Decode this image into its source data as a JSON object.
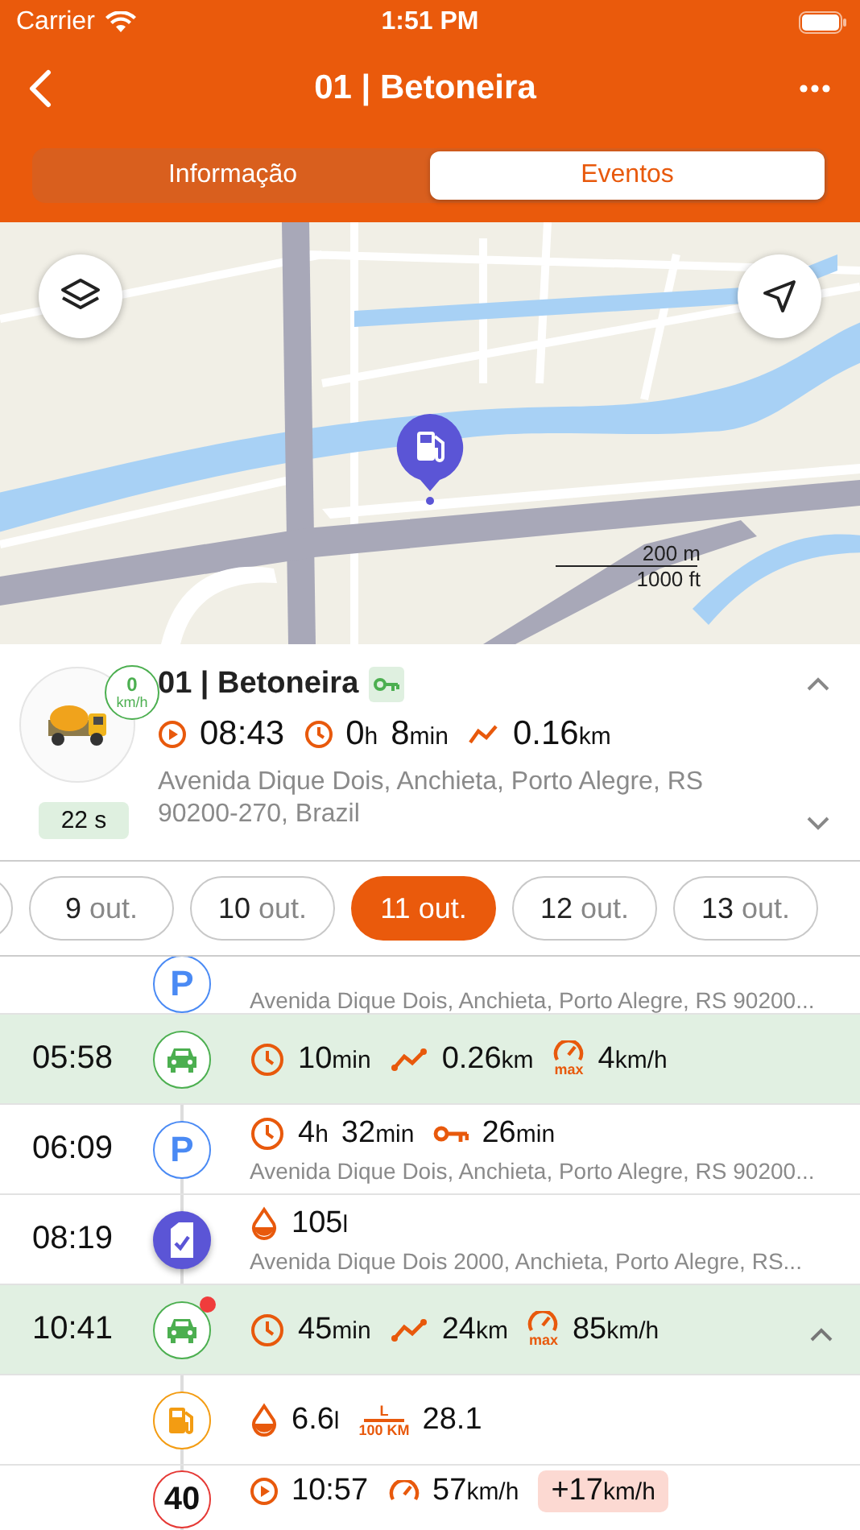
{
  "status_bar": {
    "carrier": "Carrier",
    "time": "1:51 PM"
  },
  "nav": {
    "title": "01 | Betoneira"
  },
  "tabs": [
    {
      "label": "Informação",
      "selected": false
    },
    {
      "label": "Eventos",
      "selected": true
    }
  ],
  "map": {
    "scale_metric": "200 m",
    "scale_imperial": "1000 ft"
  },
  "vehicle": {
    "speed": "0",
    "speed_unit": "km/h",
    "name": "01 | Betoneira",
    "ignition_on": true,
    "age": "22 s",
    "stats": [
      {
        "kind": "play",
        "parts": [
          {
            "v": "08:43"
          }
        ]
      },
      {
        "kind": "clock",
        "parts": [
          {
            "v": "0",
            "u": "h"
          },
          {
            "v": "8",
            "u": "min"
          }
        ]
      },
      {
        "kind": "route",
        "parts": [
          {
            "v": "0.16",
            "u": "km"
          }
        ]
      }
    ],
    "address": "Avenida Dique Dois, Anchieta, Porto Alegre, RS 90200-270, Brazil"
  },
  "dates": [
    {
      "day": "9",
      "month": "out.",
      "selected": false
    },
    {
      "day": "10",
      "month": "out.",
      "selected": false
    },
    {
      "day": "11",
      "month": "out.",
      "selected": true
    },
    {
      "day": "12",
      "month": "out.",
      "selected": false
    },
    {
      "day": "13",
      "month": "out.",
      "selected": false
    }
  ],
  "events": [
    {
      "kind": "parking",
      "badge": "P",
      "highlighted": false,
      "alert": false,
      "address": "Avenida Dique Dois, Anchieta, Porto Alegre, RS 90200..."
    },
    {
      "kind": "drive",
      "time": "05:58",
      "highlighted": true,
      "alert": false,
      "stats": [
        {
          "kind": "clock",
          "parts": [
            {
              "v": "10",
              "u": "min"
            }
          ]
        },
        {
          "kind": "route",
          "parts": [
            {
              "v": "0.26",
              "u": "km"
            }
          ]
        },
        {
          "kind": "speed",
          "label": "max",
          "parts": [
            {
              "v": "4",
              "u": "km/h"
            }
          ]
        }
      ]
    },
    {
      "kind": "parking",
      "badge": "P",
      "time": "06:09",
      "highlighted": false,
      "alert": false,
      "stats": [
        {
          "kind": "clock",
          "parts": [
            {
              "v": "4",
              "u": "h"
            },
            {
              "v": "32",
              "u": "min"
            }
          ]
        },
        {
          "kind": "key",
          "parts": [
            {
              "v": "26",
              "u": "min"
            }
          ]
        }
      ],
      "address": "Avenida Dique Dois, Anchieta, Porto Alegre, RS 90200..."
    },
    {
      "kind": "refuel",
      "time": "08:19",
      "highlighted": false,
      "alert": false,
      "stats": [
        {
          "kind": "drop",
          "parts": [
            {
              "v": "105",
              "u": "l"
            }
          ]
        }
      ],
      "address": "Avenida Dique Dois 2000, Anchieta, Porto Alegre, RS..."
    },
    {
      "kind": "drive",
      "time": "10:41",
      "highlighted": true,
      "alert": true,
      "expanded": true,
      "stats": [
        {
          "kind": "clock",
          "parts": [
            {
              "v": "45",
              "u": "min"
            }
          ]
        },
        {
          "kind": "route",
          "parts": [
            {
              "v": "24",
              "u": "km"
            }
          ]
        },
        {
          "kind": "speed",
          "label": "max",
          "parts": [
            {
              "v": "85",
              "u": "km/h"
            }
          ]
        }
      ]
    },
    {
      "kind": "fuel",
      "highlighted": false,
      "alert": false,
      "stats": [
        {
          "kind": "drop",
          "parts": [
            {
              "v": "6.6",
              "u": "l"
            }
          ]
        },
        {
          "kind": "consumption",
          "label": "L",
          "label2": "100 KM",
          "parts": [
            {
              "v": "28.1"
            }
          ]
        }
      ]
    },
    {
      "kind": "speeding",
      "badge": "40",
      "highlighted": false,
      "alert": false,
      "stats": [
        {
          "kind": "play",
          "parts": [
            {
              "v": "10:57"
            }
          ]
        },
        {
          "kind": "speed",
          "parts": [
            {
              "v": "57",
              "u": "km/h"
            }
          ]
        },
        {
          "kind": "excess",
          "parts": [
            {
              "v": "+17",
              "u": "km/h"
            }
          ]
        }
      ]
    }
  ]
}
